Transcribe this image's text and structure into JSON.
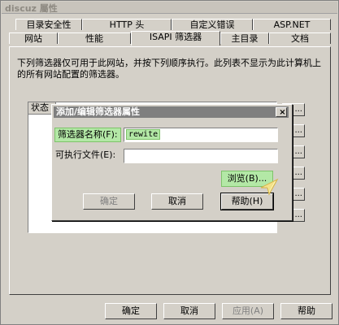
{
  "window": {
    "title": "discuz 屬性"
  },
  "tabs_row1": [
    "目录安全性",
    "HTTP 头",
    "自定义错误",
    "ASP.NET"
  ],
  "tabs_row2": [
    "网站",
    "性能",
    "ISAPI 筛选器",
    "主目录",
    "文档"
  ],
  "active_tab": "ISAPI 筛选器",
  "description": "下列筛选器仅可用于此网站，并按下列顺序执行。此列表不显示为此计算机上的所有网站配置的筛选器。",
  "list": {
    "column_header": "状态"
  },
  "side_buttons": [
    "...",
    "...",
    "...",
    "...",
    "...",
    "..."
  ],
  "dialog": {
    "title": "添加/编辑筛选器属性",
    "close_label": "×",
    "filter_name_label": "筛选器名称(F):",
    "filter_name_value": "rewite",
    "executable_label": "可执行文件(E):",
    "executable_value": "",
    "browse_label": "浏览(B)...",
    "ok_label": "确定",
    "cancel_label": "取消",
    "help_label": "帮助(H)"
  },
  "footer": {
    "ok_label": "确定",
    "cancel_label": "取消",
    "apply_label": "应用(A)",
    "help_label": "帮助"
  },
  "colors": {
    "highlight": "#b3e8a6",
    "title_bar": "#7f7f7f",
    "face": "#d4d0c8"
  },
  "icons": {
    "cursor": "mouse-pointer-icon"
  }
}
